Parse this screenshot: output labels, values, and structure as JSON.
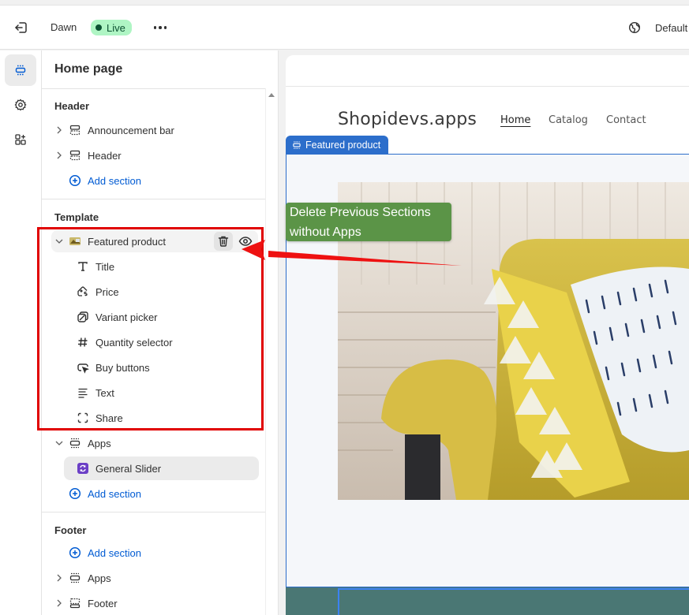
{
  "topbar": {
    "exit_label": "Exit",
    "theme_name": "Dawn",
    "status_badge": "Live",
    "more_label": "More actions",
    "locale_label": "Default"
  },
  "rail": {
    "items": [
      {
        "name": "sections",
        "active": true
      },
      {
        "name": "theme-settings",
        "active": false
      },
      {
        "name": "app-embeds",
        "active": false
      }
    ]
  },
  "sidebar": {
    "title": "Home page",
    "groups": {
      "header": {
        "label": "Header",
        "items": [
          "Announcement bar",
          "Header"
        ],
        "add_label": "Add section"
      },
      "template": {
        "label": "Template",
        "featured_product": {
          "label": "Featured product",
          "blocks": [
            "Title",
            "Price",
            "Variant picker",
            "Quantity selector",
            "Buy buttons",
            "Text",
            "Share"
          ]
        },
        "apps": {
          "label": "Apps",
          "items": [
            "General Slider"
          ]
        },
        "add_label": "Add section"
      },
      "footer": {
        "label": "Footer",
        "add_label": "Add section",
        "items": [
          "Apps",
          "Footer"
        ]
      }
    }
  },
  "preview": {
    "store_name": "Shopidevs.apps",
    "nav": [
      "Home",
      "Catalog",
      "Contact"
    ],
    "active_nav": "Home",
    "section_tag": "Featured product",
    "accent_color": "#2c6ecb"
  },
  "annotation": {
    "callout_line1": "Delete Previous Sections",
    "callout_line2": "without Apps",
    "callout_color": "#5b9447",
    "highlight_color": "#e00000"
  }
}
